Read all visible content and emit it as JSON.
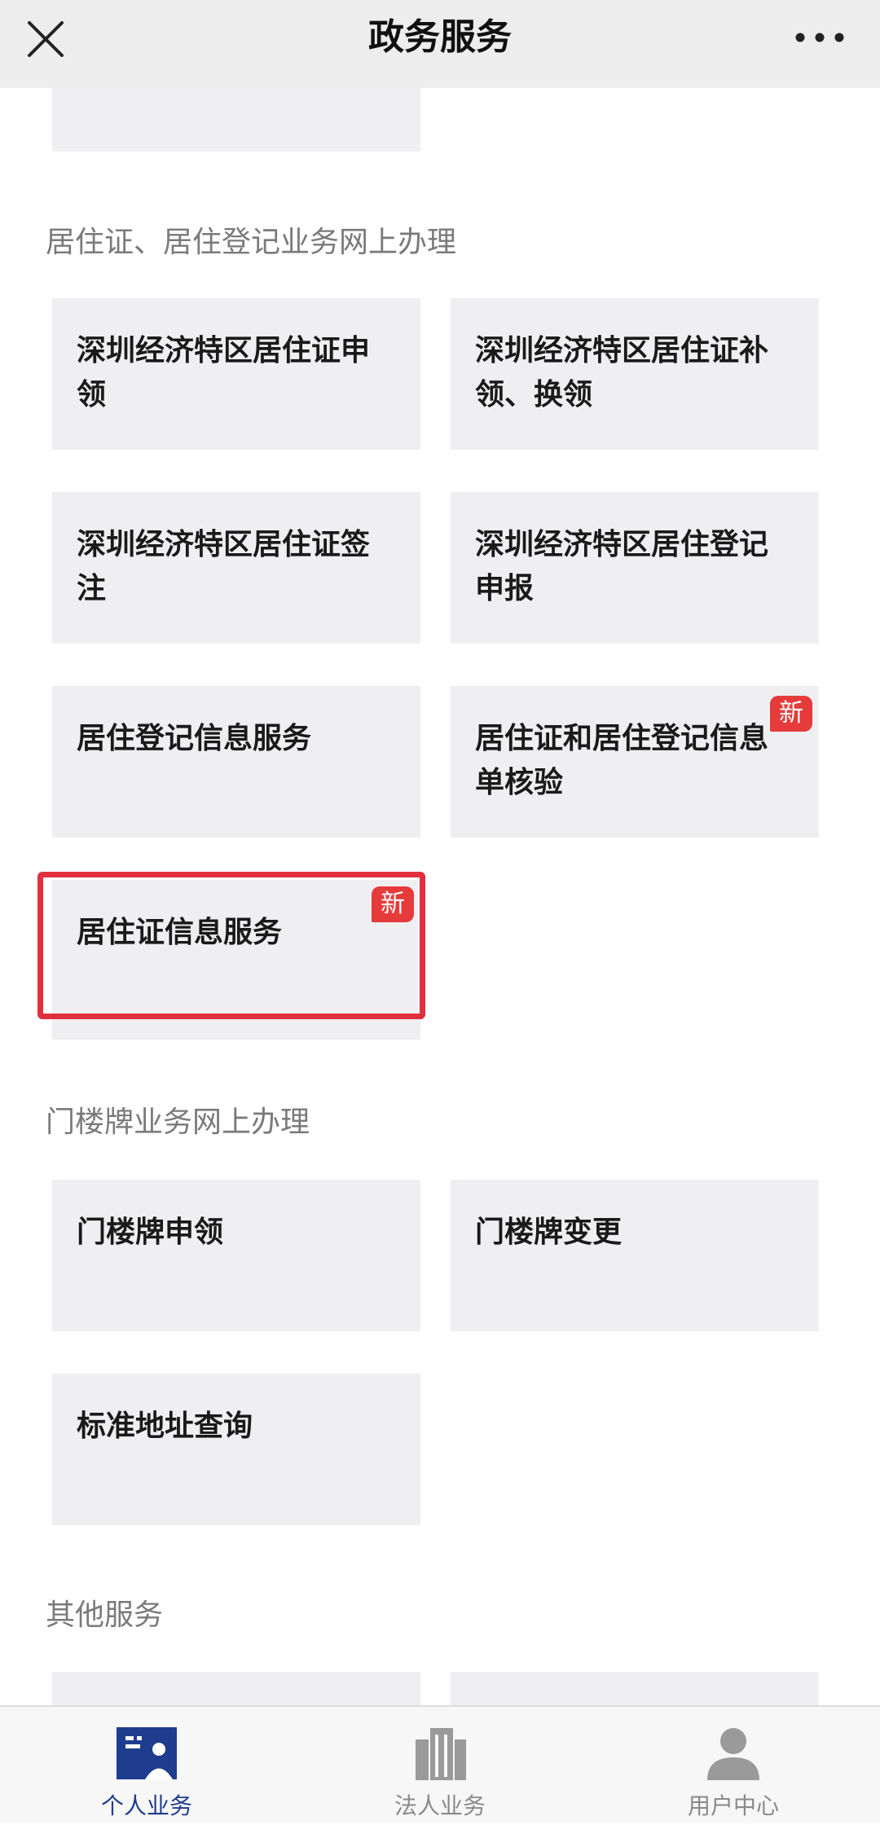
{
  "header": {
    "title": "政务服务"
  },
  "sections": {
    "residence": {
      "title": "居住证、居住登记业务网上办理",
      "cards": [
        "深圳经济特区居住证申领",
        "深圳经济特区居住证补领、换领",
        "深圳经济特区居住证签注",
        "深圳经济特区居住登记申报",
        "居住登记信息服务",
        "居住证和居住登记信息单核验",
        "居住证信息服务"
      ],
      "badge": "新"
    },
    "doorplate": {
      "title": "门楼牌业务网上办理",
      "cards": [
        "门楼牌申领",
        "门楼牌变更",
        "标准地址查询"
      ]
    },
    "other": {
      "title": "其他服务"
    }
  },
  "tabs": [
    {
      "label": "个人业务",
      "icon": "personal-business-icon",
      "active": true
    },
    {
      "label": "法人业务",
      "icon": "building-icon",
      "active": false
    },
    {
      "label": "用户中心",
      "icon": "user-icon",
      "active": false
    }
  ],
  "colors": {
    "accent": "#1f3c8f",
    "badge": "#e53b3b",
    "highlight": "#e03040",
    "card": "#efeff1"
  }
}
